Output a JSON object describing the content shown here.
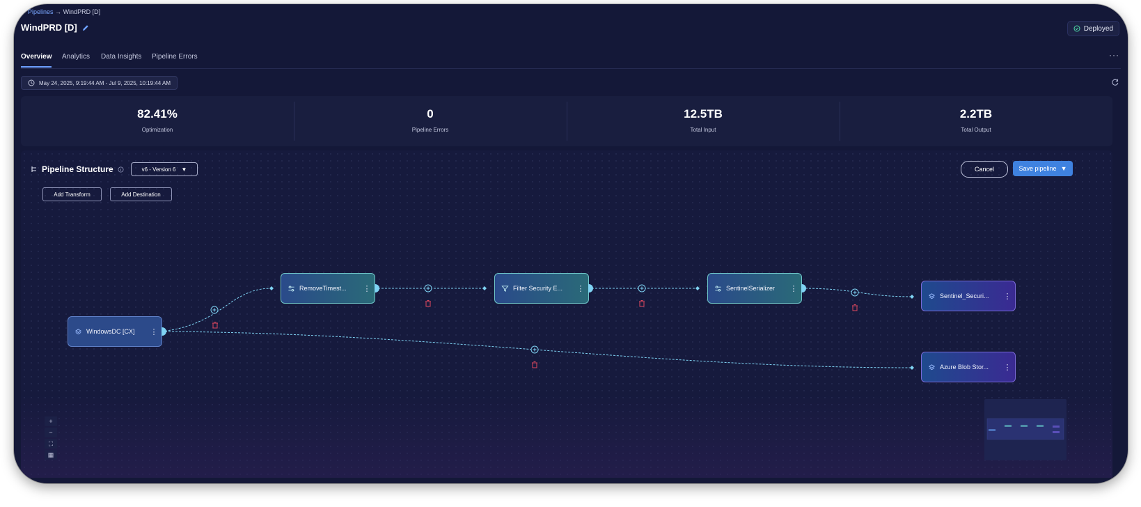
{
  "breadcrumb": {
    "parent": "Pipelines",
    "separator": "→",
    "current": "WindPRD [D]"
  },
  "page": {
    "title": "WindPRD [D]",
    "status": "Deployed"
  },
  "tabs": [
    "Overview",
    "Analytics",
    "Data Insights",
    "Pipeline Errors"
  ],
  "date_range": "May 24, 2025, 9:19:44 AM - Jul 9, 2025, 10:19:44 AM",
  "stats": [
    {
      "value": "82.41%",
      "label": "Optimization"
    },
    {
      "value": "0",
      "label": "Pipeline Errors"
    },
    {
      "value": "12.5TB",
      "label": "Total Input"
    },
    {
      "value": "2.2TB",
      "label": "Total Output"
    }
  ],
  "pipeline": {
    "title": "Pipeline Structure",
    "version": "v6 - Version 6",
    "add_transform": "Add Transform",
    "add_destination": "Add Destination",
    "cancel": "Cancel",
    "save": "Save pipeline",
    "nodes": {
      "source": "WindowsDC [CX]",
      "transform1": "RemoveTimest...",
      "transform2": "Filter Security E...",
      "transform3": "SentinelSerializer",
      "dest1": "Sentinel_Securi...",
      "dest2": "Azure Blob Stor..."
    }
  },
  "zoom_controls": [
    "+",
    "−",
    "⛶",
    "▦"
  ],
  "colors": {
    "background": "#141838",
    "accent": "#3f82e0",
    "edge": "#7fd3f3",
    "delete": "#e0485e",
    "status_ok": "#4ddba8"
  }
}
